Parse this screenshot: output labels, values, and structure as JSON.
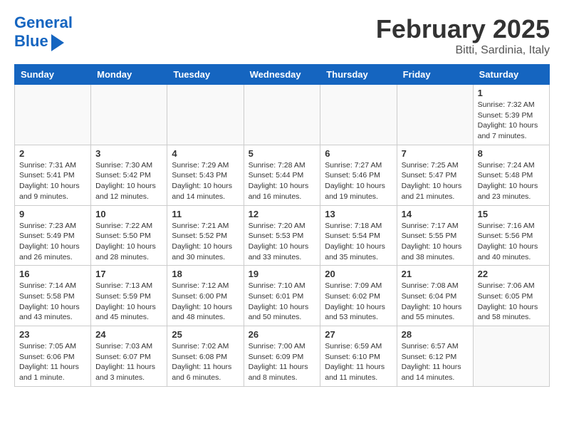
{
  "header": {
    "logo_line1": "General",
    "logo_line2": "Blue",
    "month": "February 2025",
    "location": "Bitti, Sardinia, Italy"
  },
  "weekdays": [
    "Sunday",
    "Monday",
    "Tuesday",
    "Wednesday",
    "Thursday",
    "Friday",
    "Saturday"
  ],
  "weeks": [
    [
      {
        "day": "",
        "info": ""
      },
      {
        "day": "",
        "info": ""
      },
      {
        "day": "",
        "info": ""
      },
      {
        "day": "",
        "info": ""
      },
      {
        "day": "",
        "info": ""
      },
      {
        "day": "",
        "info": ""
      },
      {
        "day": "1",
        "info": "Sunrise: 7:32 AM\nSunset: 5:39 PM\nDaylight: 10 hours and 7 minutes."
      }
    ],
    [
      {
        "day": "2",
        "info": "Sunrise: 7:31 AM\nSunset: 5:41 PM\nDaylight: 10 hours and 9 minutes."
      },
      {
        "day": "3",
        "info": "Sunrise: 7:30 AM\nSunset: 5:42 PM\nDaylight: 10 hours and 12 minutes."
      },
      {
        "day": "4",
        "info": "Sunrise: 7:29 AM\nSunset: 5:43 PM\nDaylight: 10 hours and 14 minutes."
      },
      {
        "day": "5",
        "info": "Sunrise: 7:28 AM\nSunset: 5:44 PM\nDaylight: 10 hours and 16 minutes."
      },
      {
        "day": "6",
        "info": "Sunrise: 7:27 AM\nSunset: 5:46 PM\nDaylight: 10 hours and 19 minutes."
      },
      {
        "day": "7",
        "info": "Sunrise: 7:25 AM\nSunset: 5:47 PM\nDaylight: 10 hours and 21 minutes."
      },
      {
        "day": "8",
        "info": "Sunrise: 7:24 AM\nSunset: 5:48 PM\nDaylight: 10 hours and 23 minutes."
      }
    ],
    [
      {
        "day": "9",
        "info": "Sunrise: 7:23 AM\nSunset: 5:49 PM\nDaylight: 10 hours and 26 minutes."
      },
      {
        "day": "10",
        "info": "Sunrise: 7:22 AM\nSunset: 5:50 PM\nDaylight: 10 hours and 28 minutes."
      },
      {
        "day": "11",
        "info": "Sunrise: 7:21 AM\nSunset: 5:52 PM\nDaylight: 10 hours and 30 minutes."
      },
      {
        "day": "12",
        "info": "Sunrise: 7:20 AM\nSunset: 5:53 PM\nDaylight: 10 hours and 33 minutes."
      },
      {
        "day": "13",
        "info": "Sunrise: 7:18 AM\nSunset: 5:54 PM\nDaylight: 10 hours and 35 minutes."
      },
      {
        "day": "14",
        "info": "Sunrise: 7:17 AM\nSunset: 5:55 PM\nDaylight: 10 hours and 38 minutes."
      },
      {
        "day": "15",
        "info": "Sunrise: 7:16 AM\nSunset: 5:56 PM\nDaylight: 10 hours and 40 minutes."
      }
    ],
    [
      {
        "day": "16",
        "info": "Sunrise: 7:14 AM\nSunset: 5:58 PM\nDaylight: 10 hours and 43 minutes."
      },
      {
        "day": "17",
        "info": "Sunrise: 7:13 AM\nSunset: 5:59 PM\nDaylight: 10 hours and 45 minutes."
      },
      {
        "day": "18",
        "info": "Sunrise: 7:12 AM\nSunset: 6:00 PM\nDaylight: 10 hours and 48 minutes."
      },
      {
        "day": "19",
        "info": "Sunrise: 7:10 AM\nSunset: 6:01 PM\nDaylight: 10 hours and 50 minutes."
      },
      {
        "day": "20",
        "info": "Sunrise: 7:09 AM\nSunset: 6:02 PM\nDaylight: 10 hours and 53 minutes."
      },
      {
        "day": "21",
        "info": "Sunrise: 7:08 AM\nSunset: 6:04 PM\nDaylight: 10 hours and 55 minutes."
      },
      {
        "day": "22",
        "info": "Sunrise: 7:06 AM\nSunset: 6:05 PM\nDaylight: 10 hours and 58 minutes."
      }
    ],
    [
      {
        "day": "23",
        "info": "Sunrise: 7:05 AM\nSunset: 6:06 PM\nDaylight: 11 hours and 1 minute."
      },
      {
        "day": "24",
        "info": "Sunrise: 7:03 AM\nSunset: 6:07 PM\nDaylight: 11 hours and 3 minutes."
      },
      {
        "day": "25",
        "info": "Sunrise: 7:02 AM\nSunset: 6:08 PM\nDaylight: 11 hours and 6 minutes."
      },
      {
        "day": "26",
        "info": "Sunrise: 7:00 AM\nSunset: 6:09 PM\nDaylight: 11 hours and 8 minutes."
      },
      {
        "day": "27",
        "info": "Sunrise: 6:59 AM\nSunset: 6:10 PM\nDaylight: 11 hours and 11 minutes."
      },
      {
        "day": "28",
        "info": "Sunrise: 6:57 AM\nSunset: 6:12 PM\nDaylight: 11 hours and 14 minutes."
      },
      {
        "day": "",
        "info": ""
      }
    ]
  ]
}
